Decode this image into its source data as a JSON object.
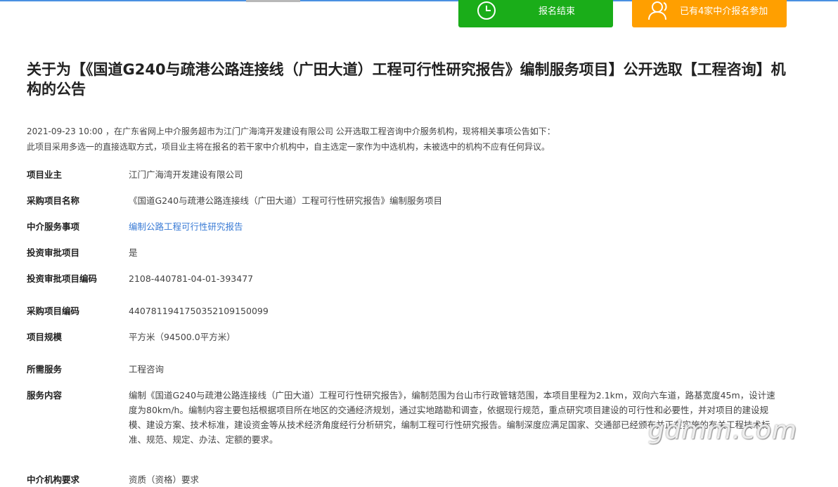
{
  "top_buttons": {
    "green_label": "报名结束",
    "orange_label": "已有4家中介报名参加",
    "green_color": "#1aad19",
    "orange_color": "#ff9f00",
    "green_icon": "clock-icon",
    "orange_icon": "users-icon"
  },
  "title": "关于为【《国道G240与疏港公路连接线（广田大道）工程可行性研究报告》编制服务项目】公开选取【工程咨询】机构的公告",
  "intro": {
    "line1": "2021-09-23 10:00 ，在广东省网上中介服务超市为江门广海湾开发建设有限公司 公开选取工程咨询中介服务机构，现将相关事项公告如下：",
    "line2": "此项目采用多选一的直接选取方式，项目业主将在报名的若干家中介机构中，自主选定一家作为中选机构，未被选中的机构不应有任何异议。"
  },
  "fields": {
    "owner": {
      "label": "项目业主",
      "value": "江门广海湾开发建设有限公司"
    },
    "project_name": {
      "label": "采购项目名称",
      "value": "《国道G240与疏港公路连接线（广田大道）工程可行性研究报告》编制服务项目"
    },
    "service_item": {
      "label": "中介服务事项",
      "value": "编制公路工程可行性研究报告"
    },
    "investment_approval": {
      "label": "投资审批项目",
      "value": "是"
    },
    "approval_code": {
      "label": "投资审批项目编码",
      "value": "2108-440781-04-01-393477"
    },
    "procurement_code": {
      "label": "采购项目编码",
      "value": "440781194175035210915009​9"
    },
    "scale": {
      "label": "项目规模",
      "value": "平方米（94500.0平方米）"
    },
    "required_service": {
      "label": "所需服务",
      "value": "工程咨询"
    },
    "service_content": {
      "label": "服务内容",
      "value": "编制《国道G240与疏港公路连接线（广田大道）工程可行性研究报告》，编制范围为台山市行政管辖范围，本项目里程为2.1km，双向六车道，路基宽度45m，设计速度为80km/h。编制内容主要包括根据项目所在地区的交通经济规划，通过实地踏勘和调查，依据现行规范，重点研究项目建设的可行性和必要性，并对项目的建设规模、建设方案、技术标准，建设资金等从技术经济角度经行分析研究，编制工程可行性研究报告。编制深度应满足国家、交通部已经颁布并正在实施的有关工程技术标准、规范、规定、办法、定额的要求。"
    },
    "cut_off": {
      "label": "中介机构要求",
      "value": "资质（资格）要求"
    }
  },
  "watermark": "gdmm.com"
}
